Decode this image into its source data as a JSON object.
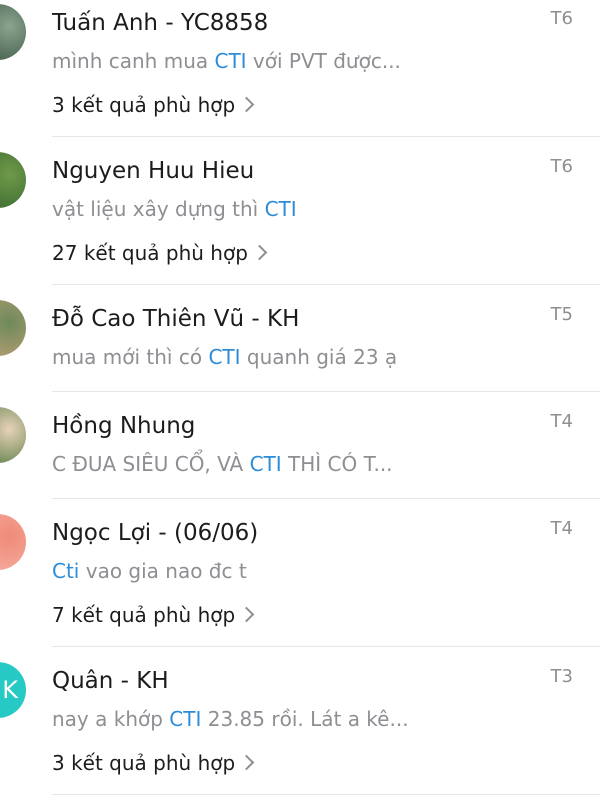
{
  "conversations": [
    {
      "name": "Tuấn Anh - YC8858",
      "date": "T6",
      "preview_before": "mình canh mua ",
      "preview_highlight": "CTI",
      "preview_after": " với PVT được...",
      "results_count": "3",
      "results_label": "kết quả phù hợp",
      "avatar_colors": [
        "#2f4a3a",
        "#8aa48f"
      ]
    },
    {
      "name": "Nguyen Huu Hieu",
      "date": "T6",
      "preview_before": "vật liệu xây dựng thì ",
      "preview_highlight": "CTI",
      "preview_after": "",
      "results_count": "27",
      "results_label": "kết quả phù hợp",
      "avatar_colors": [
        "#2e5e2a",
        "#6f9a4a"
      ]
    },
    {
      "name": "Đỗ Cao Thiên Vũ - KH",
      "date": "T5",
      "preview_before": "mua mới thì có ",
      "preview_highlight": "CTI",
      "preview_after": " quanh giá 23 ạ",
      "results_count": "",
      "results_label": "",
      "avatar_colors": [
        "#c9a27a",
        "#6d8a5a"
      ]
    },
    {
      "name": "Hồng Nhung",
      "date": "T4",
      "preview_before": "C ĐUA SIÊU CỔ, VÀ ",
      "preview_highlight": "CTI",
      "preview_after": " THÌ CÓ T...",
      "results_count": "",
      "results_label": "",
      "avatar_colors": [
        "#3a6b2e",
        "#e8d2b8"
      ]
    },
    {
      "name": "Ngọc Lợi - (06/06)",
      "date": "T4",
      "preview_before": "",
      "preview_highlight": "Cti",
      "preview_after": " vao gia nao đc t",
      "results_count": "7",
      "results_label": "kết quả phù hợp",
      "avatar_colors": [
        "#f6b4a8",
        "#f08a78"
      ]
    },
    {
      "name": "Quân - KH",
      "date": "T3",
      "preview_before": "nay a khớp ",
      "preview_highlight": "CTI",
      "preview_after": " 23.85 rồi. Lát a kê...",
      "results_count": "3",
      "results_label": "kết quả phù hợp",
      "avatar_colors": [
        "#27c9c5",
        "#27c9c5"
      ],
      "avatar_initial": "K"
    }
  ],
  "colors": {
    "highlight": "#2d8cd8",
    "secondary_text": "#8e8e93",
    "primary_text": "#1c1c1e",
    "divider": "#e6e6e6"
  }
}
